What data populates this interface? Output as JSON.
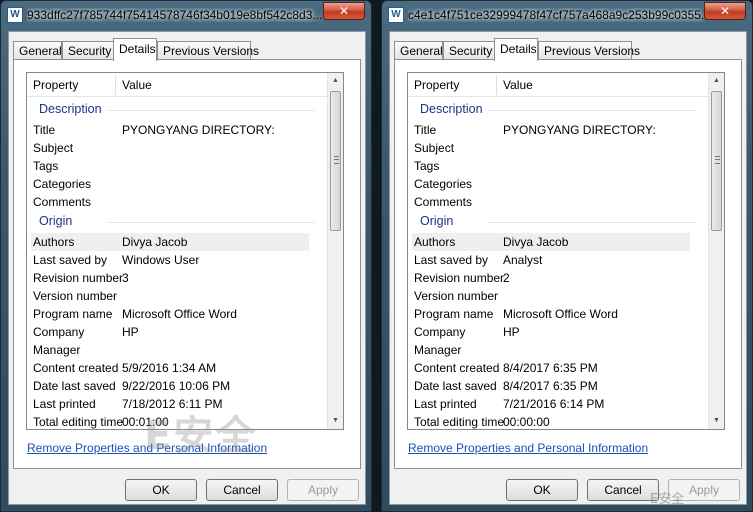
{
  "windows": [
    {
      "title": "933dffc27f785744f75414578746f34b019e8bf542c8d3...",
      "close_glyph": "✕",
      "tabs": [
        "General",
        "Security",
        "Details",
        "Previous Versions"
      ],
      "active_tab": "Details",
      "header": {
        "property": "Property",
        "value": "Value"
      },
      "groups": [
        {
          "label": "Description",
          "rows": [
            {
              "k": "Title",
              "v": "PYONGYANG DIRECTORY:"
            },
            {
              "k": "Subject",
              "v": ""
            },
            {
              "k": "Tags",
              "v": ""
            },
            {
              "k": "Categories",
              "v": ""
            },
            {
              "k": "Comments",
              "v": ""
            }
          ]
        },
        {
          "label": "Origin",
          "rows": [
            {
              "k": "Authors",
              "v": "Divya Jacob"
            },
            {
              "k": "Last saved by",
              "v": "Windows User"
            },
            {
              "k": "Revision number",
              "v": "3"
            },
            {
              "k": "Version number",
              "v": ""
            },
            {
              "k": "Program name",
              "v": "Microsoft Office Word"
            },
            {
              "k": "Company",
              "v": "HP"
            },
            {
              "k": "Manager",
              "v": ""
            },
            {
              "k": "Content created",
              "v": "5/9/2016 1:34 AM"
            },
            {
              "k": "Date last saved",
              "v": "9/22/2016 10:06 PM"
            },
            {
              "k": "Last printed",
              "v": "7/18/2012 6:11 PM"
            },
            {
              "k": "Total editing time",
              "v": "00:01:00"
            }
          ]
        }
      ],
      "link": "Remove Properties and Personal Information",
      "buttons": {
        "ok": "OK",
        "cancel": "Cancel",
        "apply": "Apply"
      },
      "watermark": "E安全"
    },
    {
      "title": "c4e1c4f751ce32999478f47cf757a468a9c253b99c0355...",
      "close_glyph": "✕",
      "tabs": [
        "General",
        "Security",
        "Details",
        "Previous Versions"
      ],
      "active_tab": "Details",
      "header": {
        "property": "Property",
        "value": "Value"
      },
      "groups": [
        {
          "label": "Description",
          "rows": [
            {
              "k": "Title",
              "v": "PYONGYANG DIRECTORY:"
            },
            {
              "k": "Subject",
              "v": ""
            },
            {
              "k": "Tags",
              "v": ""
            },
            {
              "k": "Categories",
              "v": ""
            },
            {
              "k": "Comments",
              "v": ""
            }
          ]
        },
        {
          "label": "Origin",
          "rows": [
            {
              "k": "Authors",
              "v": "Divya Jacob"
            },
            {
              "k": "Last saved by",
              "v": "Analyst"
            },
            {
              "k": "Revision number",
              "v": "2"
            },
            {
              "k": "Version number",
              "v": ""
            },
            {
              "k": "Program name",
              "v": "Microsoft Office Word"
            },
            {
              "k": "Company",
              "v": "HP"
            },
            {
              "k": "Manager",
              "v": ""
            },
            {
              "k": "Content created",
              "v": "8/4/2017 6:35 PM"
            },
            {
              "k": "Date last saved",
              "v": "8/4/2017 6:35 PM"
            },
            {
              "k": "Last printed",
              "v": "7/21/2016 6:14 PM"
            },
            {
              "k": "Total editing time",
              "v": "00:00:00"
            }
          ]
        }
      ],
      "link": "Remove Properties and Personal Information",
      "buttons": {
        "ok": "OK",
        "cancel": "Cancel",
        "apply": "Apply"
      },
      "watermark": "E安全"
    }
  ],
  "accent": {
    "group_label": "#1e3287",
    "link": "#1d4fb4",
    "close": "#c23a1f"
  },
  "icons": {
    "title_icon": "word-document-icon",
    "close": "close-icon",
    "scroll_up": "scroll-up-arrow-icon",
    "scroll_down": "scroll-down-arrow-icon"
  }
}
